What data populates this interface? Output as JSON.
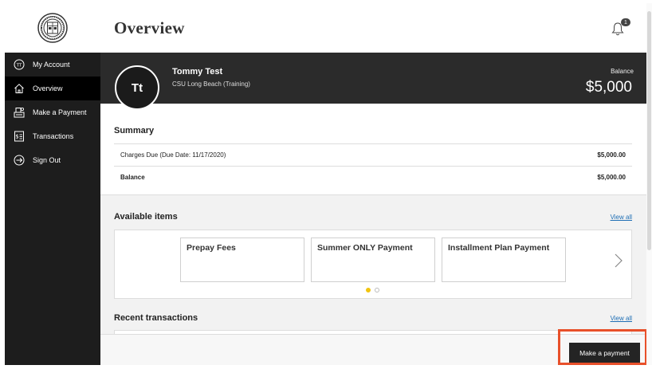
{
  "sidebar": {
    "items": [
      {
        "label": "My Account",
        "icon": "user-initials-icon",
        "initials": "TT",
        "active": false
      },
      {
        "label": "Overview",
        "icon": "home-icon",
        "active": true
      },
      {
        "label": "Make a Payment",
        "icon": "payment-icon",
        "active": false
      },
      {
        "label": "Transactions",
        "icon": "transactions-icon",
        "active": false
      },
      {
        "label": "Sign Out",
        "icon": "sign-out-icon",
        "active": false
      }
    ]
  },
  "header": {
    "title": "Overview",
    "notifications_count": "1"
  },
  "account": {
    "initials": "Tt",
    "name": "Tommy Test",
    "school": "CSU Long Beach (Training)",
    "balance_label": "Balance",
    "balance_value": "$5,000"
  },
  "summary": {
    "title": "Summary",
    "rows": [
      {
        "label": "Charges Due (Due Date: 11/17/2020)",
        "amount": "$5,000.00"
      },
      {
        "label": "Balance",
        "amount": "$5,000.00"
      }
    ]
  },
  "available_items": {
    "title": "Available items",
    "view_all": "View all",
    "tiles": [
      "Prepay Fees",
      "Summer ONLY Payment",
      "Installment Plan Payment"
    ],
    "page_count": 2,
    "current_page": 1
  },
  "recent_transactions": {
    "title": "Recent transactions",
    "view_all": "View all"
  },
  "footer": {
    "make_payment_label": "Make a payment"
  },
  "colors": {
    "sidebar_bg": "#1d1d1d",
    "banner_bg": "#2b2b2b",
    "link": "#1f6fb5",
    "active_dot": "#f1c40f",
    "highlight": "#e8502a"
  }
}
